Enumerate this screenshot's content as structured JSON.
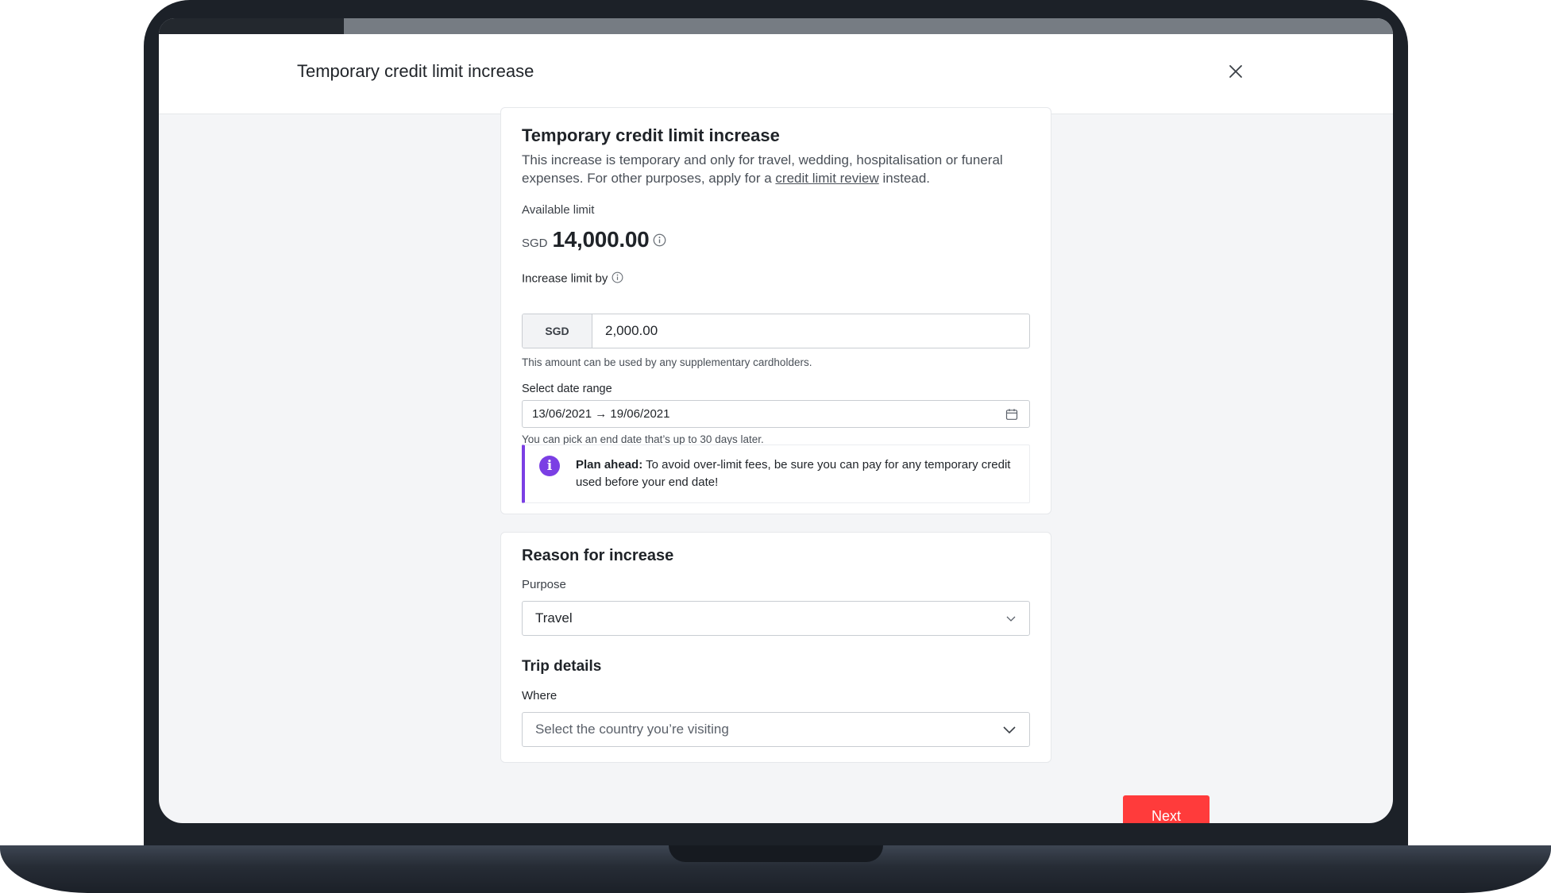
{
  "progress": {
    "percent": 15
  },
  "modal": {
    "title": "Temporary credit limit increase",
    "close_icon": "close-icon"
  },
  "limit_card": {
    "title": "Temporary credit limit increase",
    "description_before": "This increase is temporary and only for travel, wedding, hospitalisation or funeral expenses. For other purposes, apply for a ",
    "description_link": "credit limit review",
    "description_after": " instead.",
    "available_label": "Available limit",
    "available_currency": "SGD",
    "available_amount": "14,000.00",
    "increase_label": "Increase limit by",
    "increase_currency": "SGD",
    "increase_value": "2,000.00",
    "increase_hint": "This amount can be used by any supplementary cardholders.",
    "date_label": "Select date range",
    "date_value": "13/06/2021 → 19/06/2021",
    "date_hint": "You can pick an end date that’s up to 30 days later.",
    "notice_bold": "Plan ahead:",
    "notice_text": " To avoid over-limit fees, be sure you can pay for any temporary credit used before your end date!"
  },
  "reason_card": {
    "title": "Reason for increase",
    "purpose_label": "Purpose",
    "purpose_value": "Travel",
    "trip_title": "Trip details",
    "where_label": "Where",
    "where_placeholder": "Select the country you’re visiting"
  },
  "actions": {
    "next_label": "Next"
  },
  "colors": {
    "accent": "#7b3fe4",
    "primary_button": "#ff3b3b"
  }
}
